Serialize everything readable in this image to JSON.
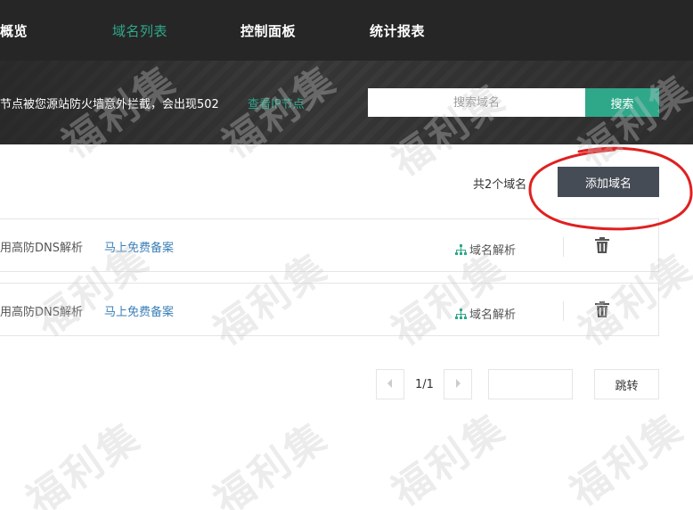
{
  "nav": {
    "items": [
      {
        "label": "概览"
      },
      {
        "label": "域名列表"
      },
      {
        "label": "控制面板"
      },
      {
        "label": "统计报表"
      }
    ],
    "active_color": "#2fa88a"
  },
  "banner": {
    "notice": "节点被您源站防火墙意外拦截，会出现502",
    "link_label": "查看IP节点"
  },
  "search": {
    "placeholder": "搜索域名",
    "value": "",
    "button_label": "搜索"
  },
  "toolbar": {
    "count_text": "共2个域名",
    "add_button_label": "添加域名"
  },
  "domains": [
    {
      "description": "用高防DNS解析",
      "icp_link": "马上免费备案",
      "dns_label": "域名解析",
      "action_icon": "trash-icon"
    },
    {
      "description": "用高防DNS解析",
      "icp_link": "马上免费备案",
      "dns_label": "域名解析",
      "action_icon": "trash-icon"
    }
  ],
  "pagination": {
    "page_info": "1/1",
    "jump_input_value": "",
    "jump_label": "跳转",
    "prev_icon": "chevron-left-icon",
    "next_icon": "chevron-right-icon"
  },
  "watermark": {
    "text": "福利集"
  },
  "colors": {
    "accent": "#2fa88a",
    "nav_bg": "#262626",
    "button_dark": "#454c55",
    "link": "#3a7fb8",
    "annotation": "#e02020"
  }
}
